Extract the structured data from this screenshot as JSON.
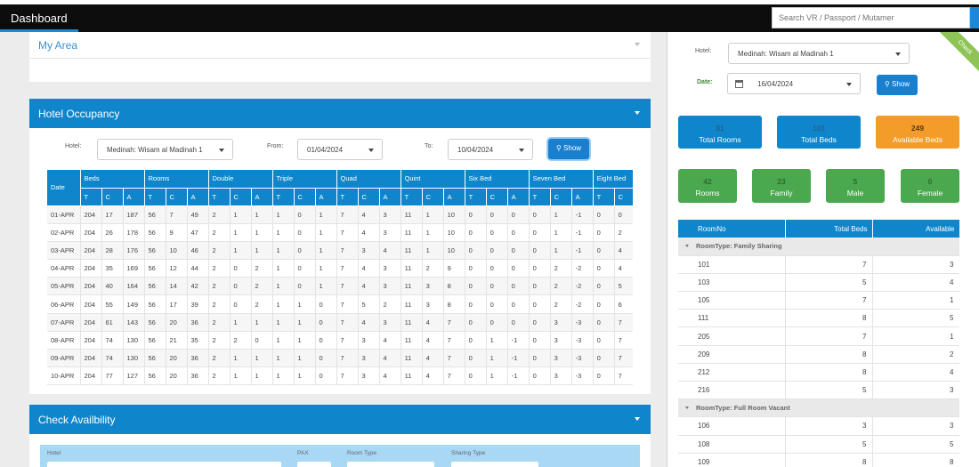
{
  "topbar": {
    "title": "Dashboard",
    "search_placeholder": "Search VR / Passport / Mutamer"
  },
  "my_area": {
    "title": "My Area"
  },
  "hotel_occupancy": {
    "title": "Hotel Occupancy",
    "hotel_label": "Hotel:",
    "hotel_value": "Medinah: Wisam al Madinah 1",
    "from_label": "From:",
    "from_value": "01/04/2024",
    "to_label": "To:",
    "to_value": "10/04/2024",
    "show_label": "Show",
    "groups": [
      "Date",
      "Beds",
      "Rooms",
      "Double",
      "Triple",
      "Quad",
      "Quint",
      "Six Bed",
      "Seven Bed",
      "Eight Bed"
    ],
    "subheaders": [
      "T",
      "C",
      "A"
    ],
    "rows": [
      [
        "01-APR",
        "204",
        "17",
        "187",
        "56",
        "7",
        "49",
        "2",
        "1",
        "1",
        "1",
        "0",
        "1",
        "7",
        "4",
        "3",
        "11",
        "1",
        "10",
        "0",
        "0",
        "0",
        "0",
        "1",
        "-1",
        "0",
        "0"
      ],
      [
        "02-APR",
        "204",
        "26",
        "178",
        "56",
        "9",
        "47",
        "2",
        "1",
        "1",
        "1",
        "0",
        "1",
        "7",
        "4",
        "3",
        "11",
        "1",
        "10",
        "0",
        "0",
        "0",
        "0",
        "1",
        "-1",
        "0",
        "2"
      ],
      [
        "03-APR",
        "204",
        "28",
        "176",
        "56",
        "10",
        "46",
        "2",
        "1",
        "1",
        "1",
        "0",
        "1",
        "7",
        "3",
        "4",
        "11",
        "1",
        "10",
        "0",
        "0",
        "0",
        "0",
        "1",
        "-1",
        "0",
        "4"
      ],
      [
        "04-APR",
        "204",
        "35",
        "169",
        "56",
        "12",
        "44",
        "2",
        "0",
        "2",
        "1",
        "0",
        "1",
        "7",
        "4",
        "3",
        "11",
        "2",
        "9",
        "0",
        "0",
        "0",
        "0",
        "2",
        "-2",
        "0",
        "4"
      ],
      [
        "05-APR",
        "204",
        "40",
        "164",
        "56",
        "14",
        "42",
        "2",
        "0",
        "2",
        "1",
        "0",
        "1",
        "7",
        "4",
        "3",
        "11",
        "3",
        "8",
        "0",
        "0",
        "0",
        "0",
        "2",
        "-2",
        "0",
        "5"
      ],
      [
        "06-APR",
        "204",
        "55",
        "149",
        "56",
        "17",
        "39",
        "2",
        "0",
        "2",
        "1",
        "1",
        "0",
        "7",
        "5",
        "2",
        "11",
        "3",
        "8",
        "0",
        "0",
        "0",
        "0",
        "2",
        "-2",
        "0",
        "6"
      ],
      [
        "07-APR",
        "204",
        "61",
        "143",
        "56",
        "20",
        "36",
        "2",
        "1",
        "1",
        "1",
        "1",
        "0",
        "7",
        "4",
        "3",
        "11",
        "4",
        "7",
        "0",
        "0",
        "0",
        "0",
        "3",
        "-3",
        "0",
        "7"
      ],
      [
        "08-APR",
        "204",
        "74",
        "130",
        "56",
        "21",
        "35",
        "2",
        "2",
        "0",
        "1",
        "1",
        "0",
        "7",
        "3",
        "4",
        "11",
        "4",
        "7",
        "0",
        "1",
        "-1",
        "0",
        "3",
        "-3",
        "0",
        "7"
      ],
      [
        "09-APR",
        "204",
        "74",
        "130",
        "56",
        "20",
        "36",
        "2",
        "1",
        "1",
        "1",
        "1",
        "0",
        "7",
        "3",
        "4",
        "11",
        "4",
        "7",
        "0",
        "1",
        "-1",
        "0",
        "3",
        "-3",
        "0",
        "7"
      ],
      [
        "10-APR",
        "204",
        "77",
        "127",
        "56",
        "20",
        "36",
        "2",
        "1",
        "1",
        "1",
        "1",
        "0",
        "7",
        "3",
        "4",
        "11",
        "4",
        "7",
        "0",
        "1",
        "-1",
        "0",
        "3",
        "-3",
        "0",
        "7"
      ]
    ]
  },
  "check_availability": {
    "title": "Check Availbility",
    "fields": [
      "Hotel",
      "PAX",
      "Room Type",
      "Sharing Type"
    ]
  },
  "right_panel": {
    "ribbon": "Check",
    "hotel_label": "Hotel:",
    "hotel_value": "Medinah: Wisam al Madinah 1",
    "date_label": "Date:",
    "date_value": "16/04/2024",
    "show_label": "Show",
    "stats_top": [
      {
        "value": "31",
        "label": "Total Rooms",
        "color": "#0f86cc",
        "value_color": "#2a5d8a"
      },
      {
        "value": "101",
        "label": "Total Beds",
        "color": "#0f86cc",
        "value_color": "#2a5d8a"
      },
      {
        "value": "249",
        "label": "Available Beds",
        "color": "#f39c2a",
        "value_color": "#5b3a0e"
      }
    ],
    "stats_bottom": [
      {
        "value": "42",
        "label": "Rooms",
        "color": "#4aa84e",
        "value_color": "#2e6a30"
      },
      {
        "value": "23",
        "label": "Family",
        "color": "#4aa84e",
        "value_color": "#2e6a30"
      },
      {
        "value": "5",
        "label": "Male",
        "color": "#4aa84e",
        "value_color": "#2e6a30"
      },
      {
        "value": "0",
        "label": "Female",
        "color": "#4aa84e",
        "value_color": "#2e6a30"
      }
    ],
    "room_table": {
      "headers": [
        "RoomNo",
        "Total Beds",
        "Available"
      ],
      "groups": [
        {
          "label": "RoomType: Family Sharing",
          "rows": [
            [
              "101",
              "7",
              "3"
            ],
            [
              "103",
              "5",
              "4"
            ],
            [
              "105",
              "7",
              "1"
            ],
            [
              "111",
              "8",
              "5"
            ],
            [
              "205",
              "7",
              "1"
            ],
            [
              "209",
              "8",
              "2"
            ],
            [
              "212",
              "8",
              "4"
            ],
            [
              "216",
              "5",
              "3"
            ]
          ]
        },
        {
          "label": "RoomType: Full Room Vacant",
          "rows": [
            [
              "106",
              "3",
              "3"
            ],
            [
              "108",
              "5",
              "5"
            ],
            [
              "109",
              "8",
              "8"
            ]
          ]
        }
      ]
    }
  }
}
